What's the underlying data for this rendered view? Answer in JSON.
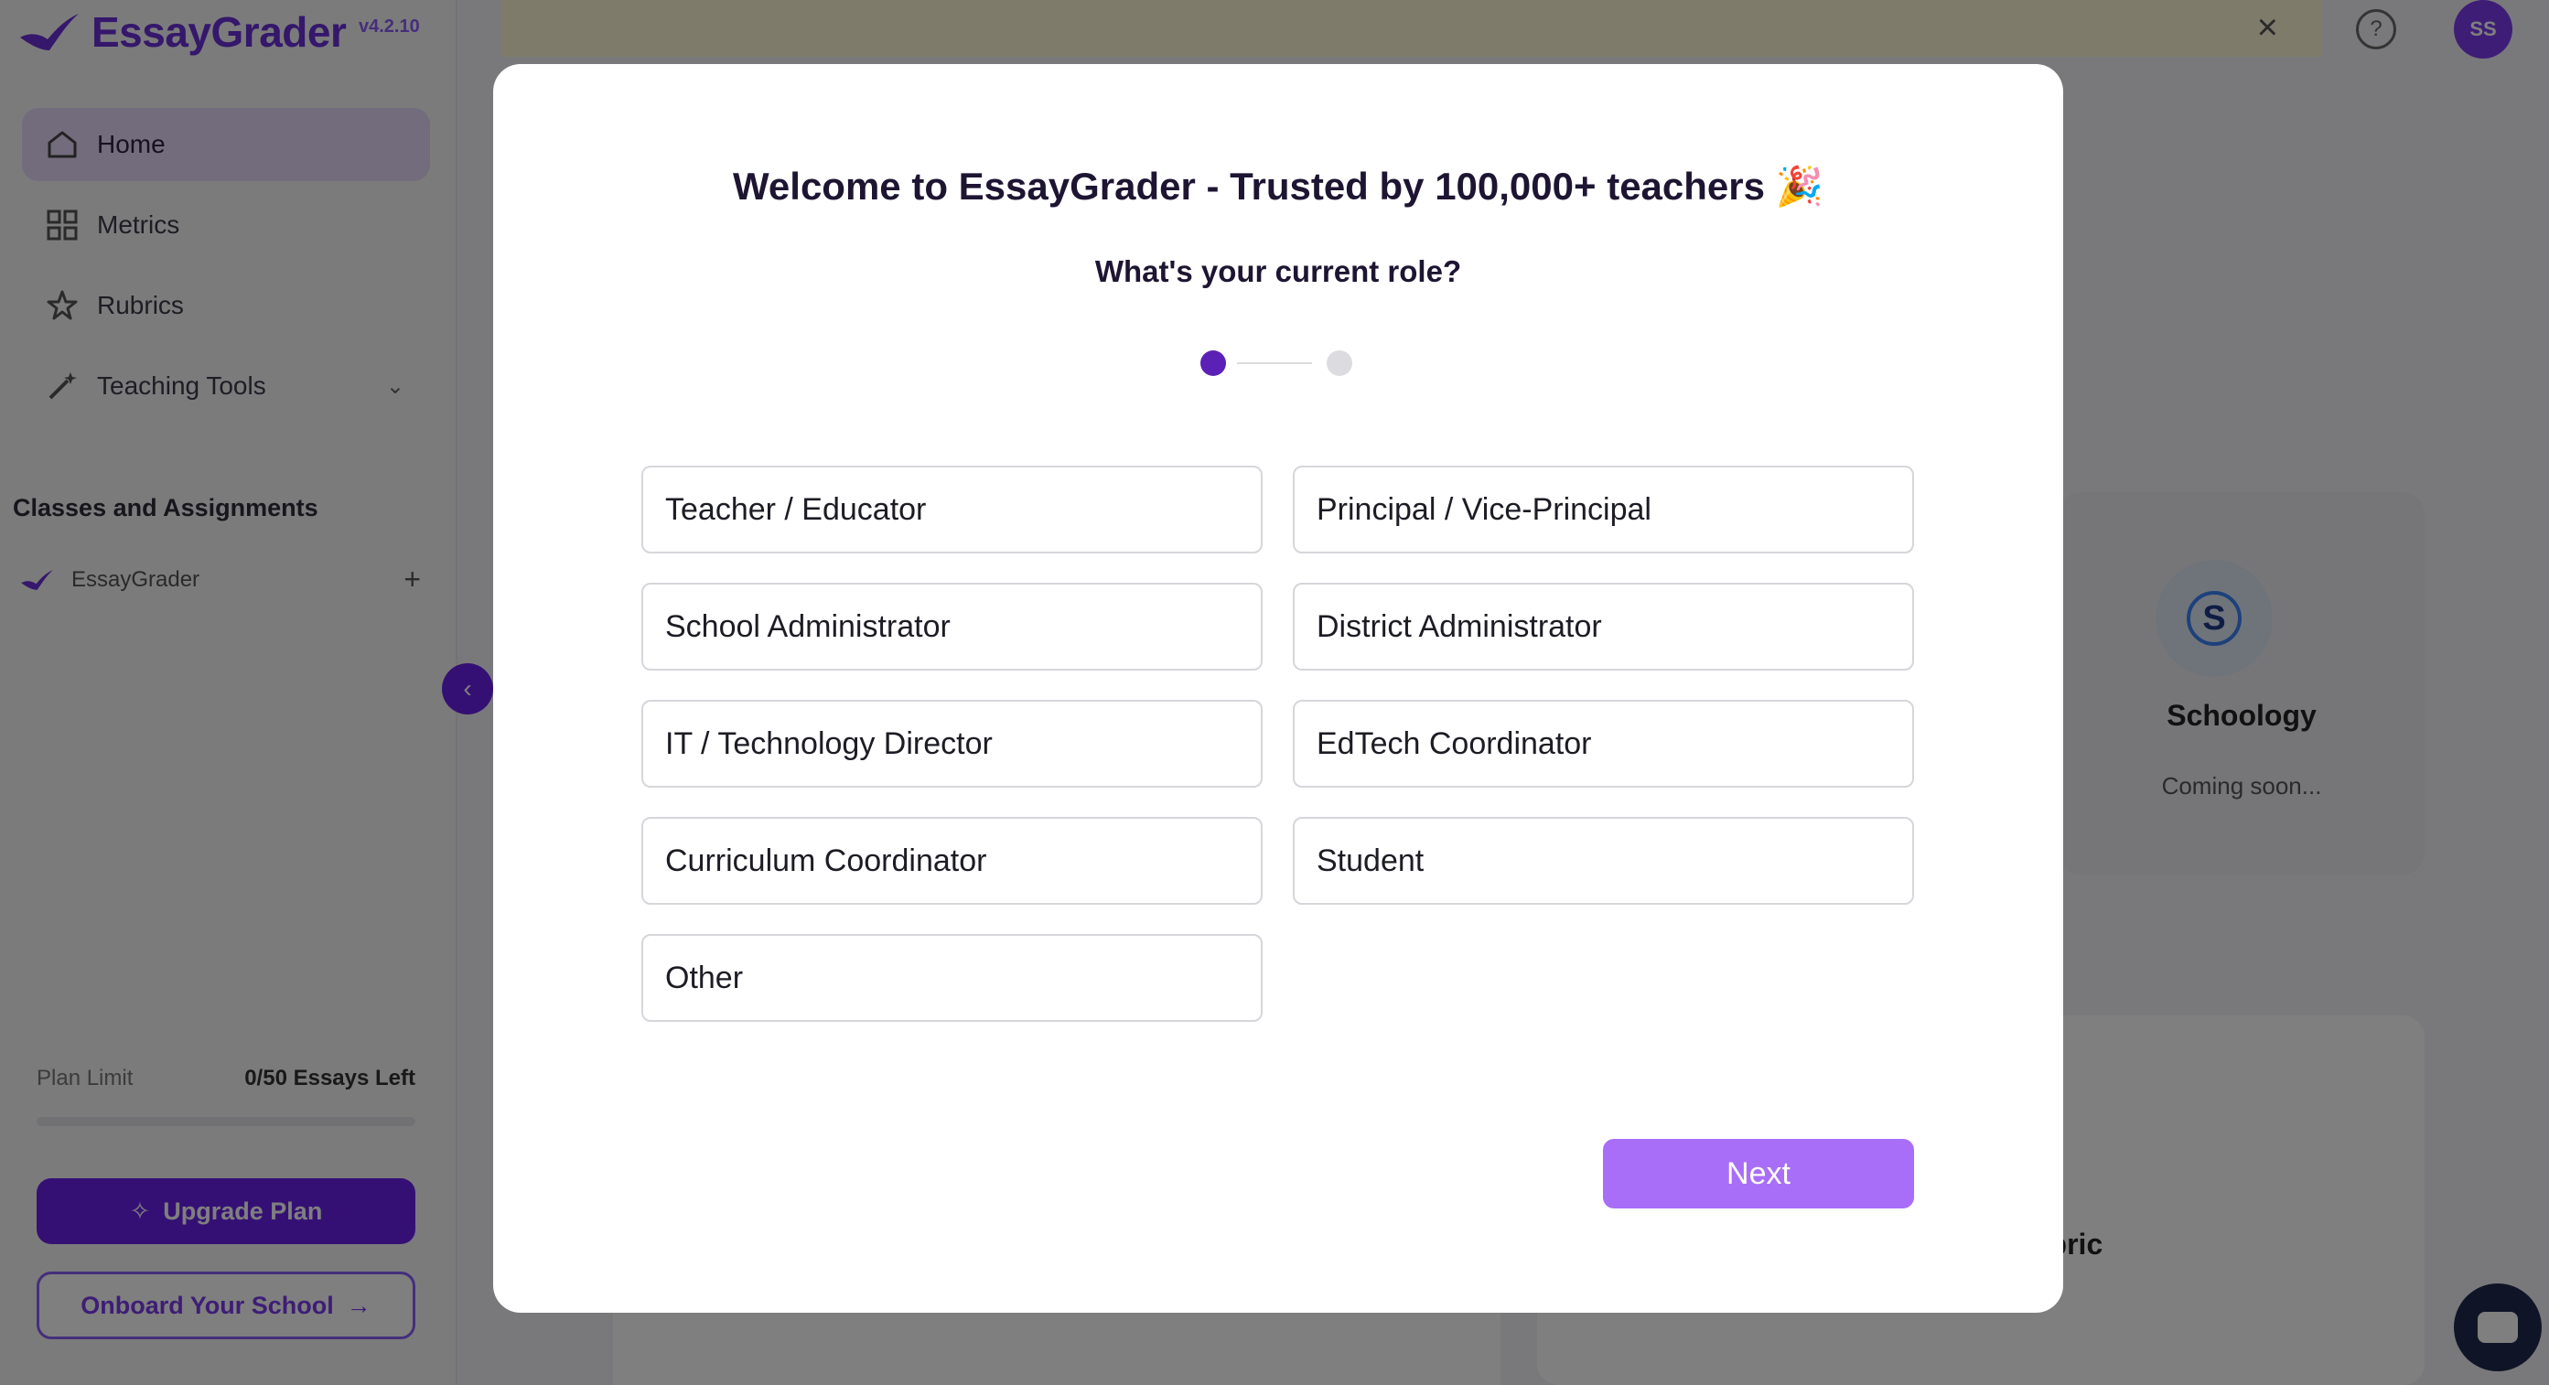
{
  "app": {
    "name": "EssayGrader",
    "version": "v4.2.10"
  },
  "sidebar": {
    "nav": [
      {
        "label": "Home",
        "icon": "home-icon"
      },
      {
        "label": "Metrics",
        "icon": "grid-icon"
      },
      {
        "label": "Rubrics",
        "icon": "star-icon"
      },
      {
        "label": "Teaching Tools",
        "icon": "wand-icon"
      }
    ],
    "section_title": "Classes and Assignments",
    "class_name": "EssayGrader",
    "plan_label": "Plan Limit",
    "plan_value": "0/50 Essays Left",
    "upgrade_label": "Upgrade Plan",
    "onboard_label": "Onboard Your School"
  },
  "header": {
    "avatar_initials": "SS"
  },
  "background_cards": {
    "schoology_name": "Schoology",
    "schoology_status": "Coming soon...",
    "lower_card_text": "ubric"
  },
  "modal": {
    "title": "Welcome to EssayGrader - Trusted by 100,000+ teachers 🎉",
    "subtitle": "What's your current role?",
    "current_step": 1,
    "total_steps": 2,
    "options": [
      "Teacher / Educator",
      "Principal / Vice-Principal",
      "School Administrator",
      "District Administrator",
      "IT / Technology Director",
      "EdTech Coordinator",
      "Curriculum Coordinator",
      "Student",
      "Other"
    ],
    "next_label": "Next"
  },
  "colors": {
    "brand_purple": "#6b21e8",
    "step_active": "#5b21b6",
    "next_button": "#a86ef8"
  }
}
